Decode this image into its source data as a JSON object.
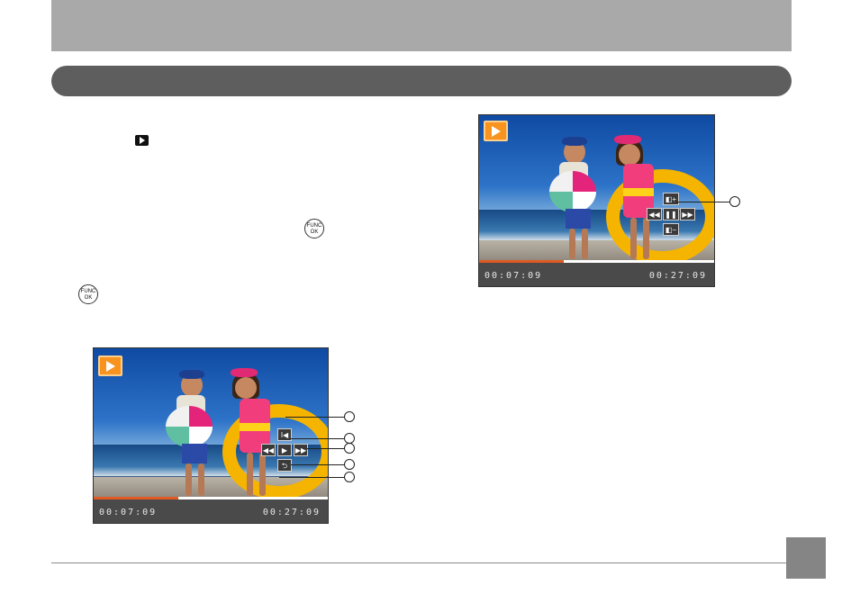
{
  "screens": {
    "a": {
      "elapsed": "00:07:09",
      "total": "00:27:09",
      "progress": 0.36
    },
    "b": {
      "elapsed": "00:07:09",
      "total": "00:27:09",
      "progress": 0.36
    }
  },
  "func_button": {
    "top_label": "FUNC",
    "bottom_label": "OK"
  },
  "controls_a": {
    "skip_back": "I◀",
    "rewind": "◀◀",
    "play": "▶",
    "fast_forward": "▶▶",
    "return": "⮌"
  },
  "controls_b": {
    "volume_up": "◧+",
    "rewind": "◀◀",
    "pause": "❚❚",
    "fast_forward": "▶▶",
    "volume_down": "◧−"
  },
  "colors": {
    "header_band": "#a9a9a9",
    "section_bar": "#5e5e5e",
    "progress_fill": "#e05a24",
    "play_badge": "#f7931e"
  },
  "icons": [
    "playback-mode-icon",
    "func-ok-button-icon",
    "play-badge-icon"
  ]
}
